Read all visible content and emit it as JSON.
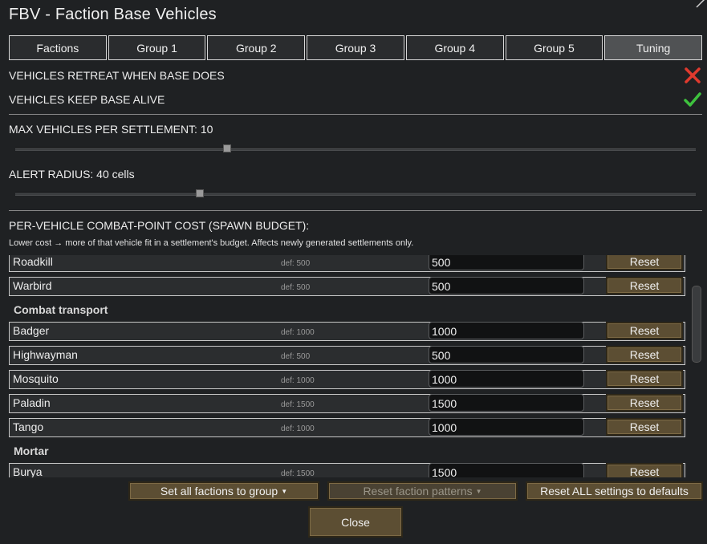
{
  "window": {
    "title": "FBV - Faction Base Vehicles"
  },
  "tabs": [
    {
      "label": "Factions",
      "active": false
    },
    {
      "label": "Group 1",
      "active": false
    },
    {
      "label": "Group 2",
      "active": false
    },
    {
      "label": "Group 3",
      "active": false
    },
    {
      "label": "Group 4",
      "active": false
    },
    {
      "label": "Group 5",
      "active": false
    },
    {
      "label": "Tuning",
      "active": true
    }
  ],
  "options": {
    "retreat": {
      "label": "VEHICLES RETREAT WHEN BASE DOES",
      "value": false
    },
    "keep_alive": {
      "label": "VEHICLES KEEP BASE ALIVE",
      "value": true
    }
  },
  "sliders": {
    "max_vehicles": {
      "label": "MAX VEHICLES PER SETTLEMENT: 10",
      "fraction": 0.31
    },
    "alert_radius": {
      "label": "ALERT RADIUS: 40 cells",
      "fraction": 0.27
    }
  },
  "cost_section": {
    "heading": "PER-VEHICLE COMBAT-POINT COST (SPAWN BUDGET):",
    "note": "Lower cost → more of that vehicle fit in a settlement's budget. Affects newly generated settlements only."
  },
  "list": {
    "reset_label": "Reset",
    "rows_top": [
      {
        "name": "Roadkill",
        "def": "def: 500",
        "value": "500"
      },
      {
        "name": "Warbird",
        "def": "def: 500",
        "value": "500"
      }
    ],
    "group_combat": "Combat transport",
    "rows_combat": [
      {
        "name": "Badger",
        "def": "def: 1000",
        "value": "1000"
      },
      {
        "name": "Highwayman",
        "def": "def: 500",
        "value": "500"
      },
      {
        "name": "Mosquito",
        "def": "def: 1000",
        "value": "1000"
      },
      {
        "name": "Paladin",
        "def": "def: 1500",
        "value": "1500"
      },
      {
        "name": "Tango",
        "def": "def: 1000",
        "value": "1000"
      }
    ],
    "group_mortar": "Mortar",
    "rows_mortar": [
      {
        "name": "Burya",
        "def": "def: 1500",
        "value": "1500"
      }
    ]
  },
  "footer": {
    "set_all": "Set all factions to group",
    "reset_patterns": "Reset faction patterns",
    "reset_all": "Reset ALL settings to defaults",
    "close": "Close"
  },
  "colors": {
    "reset_button": "#5c4e33",
    "cross": "#e03a2e",
    "check": "#3ec23e"
  }
}
